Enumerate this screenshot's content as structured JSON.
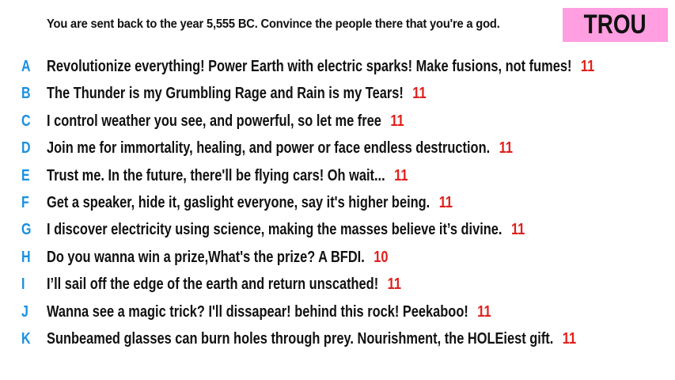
{
  "prompt": "You are sent back to the year 5,555 BC. Convince the people there that you're a god.",
  "badge": {
    "label": "TROU",
    "color": "#ff9ee0"
  },
  "colors": {
    "letter": "#1a8fe0",
    "score": "#e0201c",
    "text": "#111111"
  },
  "answers": [
    {
      "letter": "A",
      "text": "Revolutionize everything! Power Earth with electric sparks! Make fusions, not fumes!",
      "score": "11"
    },
    {
      "letter": "B",
      "text": "The Thunder is my Grumbling Rage and Rain is my Tears!",
      "score": "11"
    },
    {
      "letter": "C",
      "text": "I control weather you see, and powerful, so let me free",
      "score": "11"
    },
    {
      "letter": "D",
      "text": "Join me for immortality, healing, and power or face endless destruction.",
      "score": "11"
    },
    {
      "letter": "E",
      "text": "Trust me. In the future, there'll be flying cars! Oh wait...",
      "score": "11"
    },
    {
      "letter": "F",
      "text": "Get a speaker, hide it, gaslight everyone, say it's higher being.",
      "score": "11"
    },
    {
      "letter": "G",
      "text": "I discover electricity using science, making the masses believe it’s divine.",
      "score": "11"
    },
    {
      "letter": "H",
      "text": "Do you wanna win a prize,What's the prize? A BFDI.",
      "score": "10"
    },
    {
      "letter": "I",
      "text": "I’ll sail off the edge of the earth and return unscathed!",
      "score": "11"
    },
    {
      "letter": "J",
      "text": "Wanna see a magic trick? I'll dissapear! behind this rock! Peekaboo!",
      "score": "11"
    },
    {
      "letter": "K",
      "text": "Sunbeamed glasses can burn holes through prey. Nourishment, the HOLEiest gift.",
      "score": "11"
    }
  ]
}
